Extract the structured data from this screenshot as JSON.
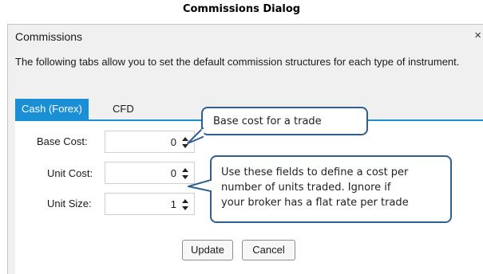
{
  "caption": "Commissions Dialog",
  "window": {
    "title": "Commissions",
    "close_glyph": "×"
  },
  "description": "The following tabs allow you to set the default commission structures for each type of instrument.",
  "tabs": [
    {
      "label": "Cash (Forex)",
      "active": true
    },
    {
      "label": "CFD",
      "active": false
    }
  ],
  "fields": [
    {
      "label": "Base Cost:",
      "value": "0"
    },
    {
      "label": "Unit Cost:",
      "value": "0"
    },
    {
      "label": "Unit Size:",
      "value": "1"
    }
  ],
  "buttons": {
    "update": "Update",
    "cancel": "Cancel"
  },
  "callouts": {
    "base_cost": "Base cost for a trade",
    "unit_fields": [
      "Use these fields to define a cost per",
      "number of units traded.  Ignore if",
      "your broker has a flat rate per trade"
    ]
  },
  "colors": {
    "accent": "#1b8fd6",
    "callout_border": "#2f5f92"
  },
  "icons": {
    "spinner": "up-down-arrows-icon",
    "close": "close-icon"
  }
}
